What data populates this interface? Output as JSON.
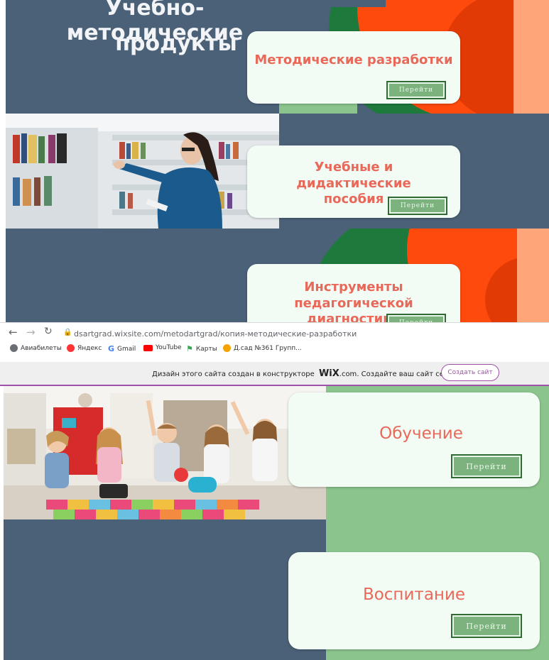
{
  "top_section": {
    "heading_line1": "Учебно-методические",
    "heading_line2": "продукты",
    "cards": [
      {
        "title": "Методические разработки",
        "button": "Перейти"
      },
      {
        "title": "Учебные и дидактические пособия",
        "button": "Перейти"
      },
      {
        "title": "Инструменты педагогической диагностики",
        "button": "Перейти"
      }
    ]
  },
  "browser": {
    "url": "dsartgrad.wixsite.com/metodartgrad/копия-методические-разработки",
    "bookmarks": [
      {
        "label": "Авиабилеты",
        "icon": "globe-icon",
        "color": "#5f6368"
      },
      {
        "label": "Яндекс",
        "icon": "yandex-icon",
        "color": "#f33"
      },
      {
        "label": "Gmail",
        "icon": "google-icon",
        "color": "#4285f4"
      },
      {
        "label": "YouTube",
        "icon": "youtube-icon",
        "color": "#ff0000"
      },
      {
        "label": "Карты",
        "icon": "maps-pin-icon",
        "color": "#34a853"
      },
      {
        "label": "Д.сад №361 Групп...",
        "icon": "bookmark-site-icon",
        "color": "#f4a300"
      }
    ]
  },
  "wix_banner": {
    "text_before": "Дизайн этого сайта создан в конструкторе",
    "brand_wix": "WiX",
    "brand_domain": ".com",
    "text_after": ". Создайте ваш сайт сегодня.",
    "button": "Создать сайт",
    "accent": "#a050a8"
  },
  "bottom_section": {
    "cards": [
      {
        "title": "Обучение",
        "button": "Перейти"
      },
      {
        "title": "Воспитание",
        "button": "Перейти"
      }
    ]
  },
  "colors": {
    "slate": "#4b6178",
    "green": "#8bc48c",
    "orange": "#ff4a0d",
    "dark_green": "#1e7a3c",
    "peach": "#ffa57a",
    "title_coral": "#e8695a",
    "button_green": "#7bb27d"
  }
}
